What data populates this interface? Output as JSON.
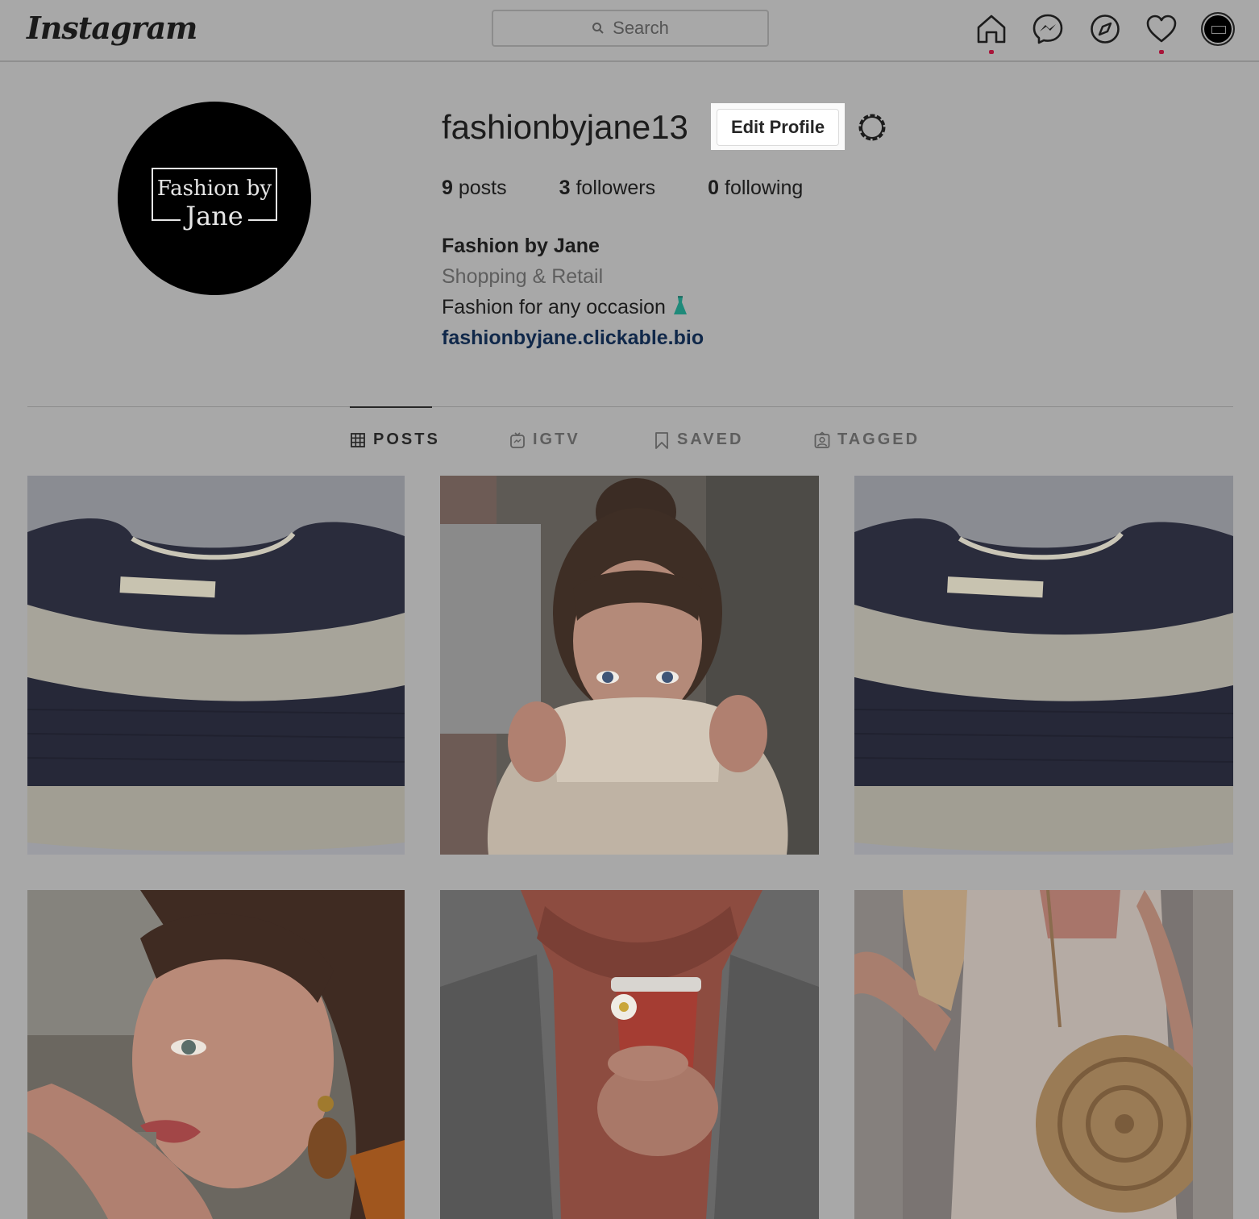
{
  "app": {
    "logo_text": "Instagram"
  },
  "search": {
    "placeholder": "Search"
  },
  "nav": {
    "icons": [
      "home-icon",
      "messenger-icon",
      "explore-icon",
      "activity-heart-icon",
      "profile-avatar"
    ],
    "notification_color": "#a8163a"
  },
  "profile": {
    "username": "fashionbyjane13",
    "edit_label": "Edit Profile",
    "avatar_line1": "Fashion by",
    "avatar_line2": "Jane",
    "stats": {
      "posts_count": "9",
      "posts_label": "posts",
      "followers_count": "3",
      "followers_label": "followers",
      "following_count": "0",
      "following_label": "following"
    },
    "bio": {
      "name": "Fashion by Jane",
      "category": "Shopping & Retail",
      "description": "Fashion for any occasion",
      "link": "fashionbyjane.clickable.bio"
    }
  },
  "tabs": [
    {
      "label": "POSTS",
      "icon": "grid-icon",
      "active": true
    },
    {
      "label": "IGTV",
      "icon": "igtv-icon",
      "active": false
    },
    {
      "label": "SAVED",
      "icon": "bookmark-icon",
      "active": false
    },
    {
      "label": "TAGGED",
      "icon": "tagged-icon",
      "active": false
    }
  ],
  "posts": [
    {
      "subject": "striped knit sweater"
    },
    {
      "subject": "woman in cream knit sweater"
    },
    {
      "subject": "striped knit sweater"
    },
    {
      "subject": "woman portrait with earrings"
    },
    {
      "subject": "red scarf and coffee cup"
    },
    {
      "subject": "white dress with wicker bag"
    }
  ]
}
